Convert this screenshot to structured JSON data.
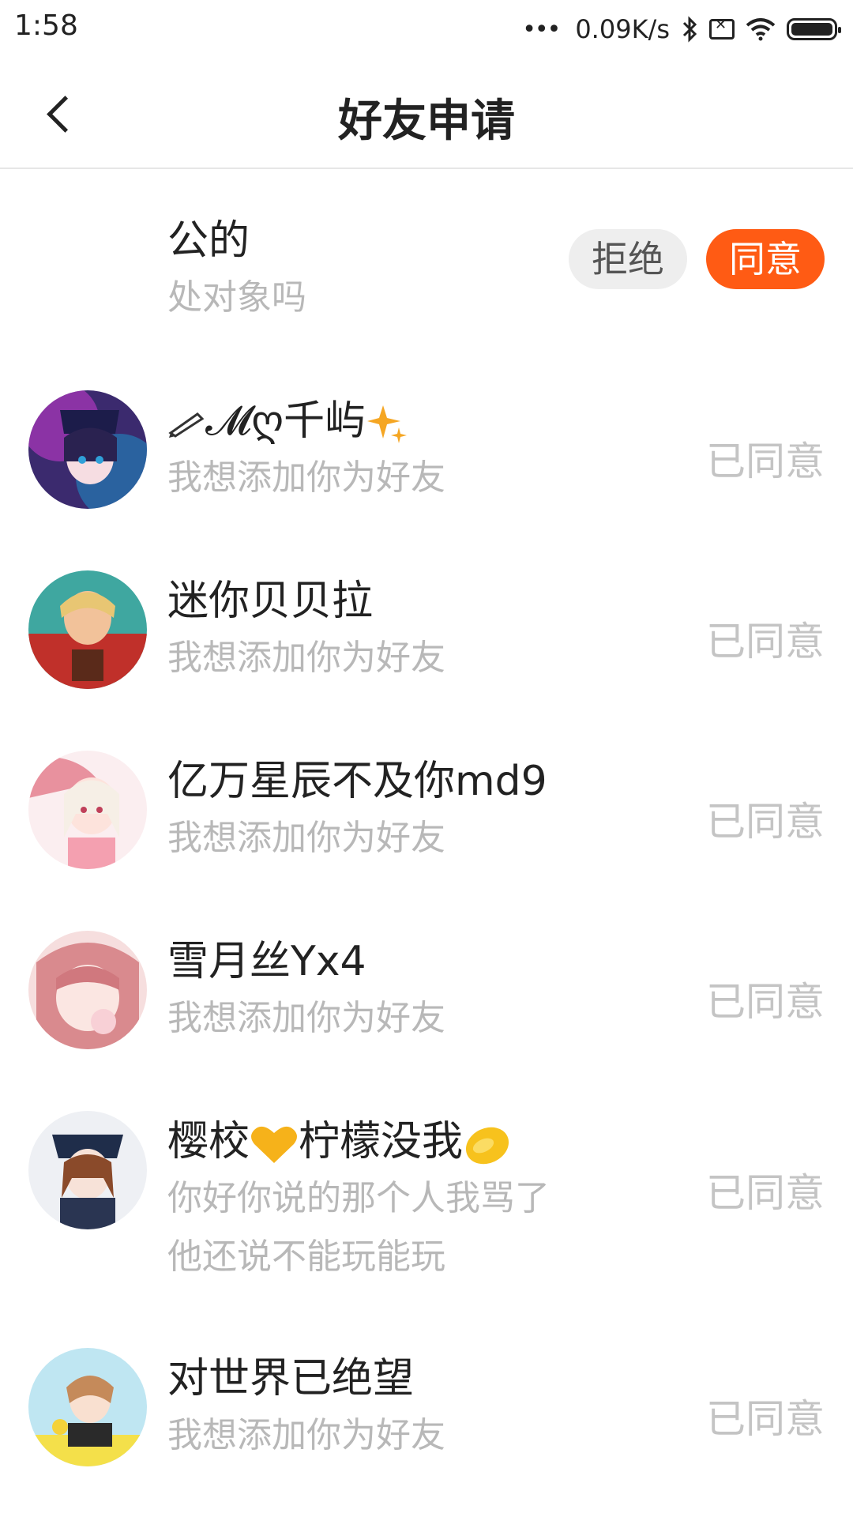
{
  "status_bar": {
    "time": "1:58",
    "network_speed": "0.09K/s",
    "icons": [
      "more-dots-icon",
      "bluetooth-icon",
      "no-sim-icon",
      "wifi-icon",
      "battery-icon"
    ]
  },
  "header": {
    "title": "好友申请",
    "back_icon": "chevron-left-icon"
  },
  "requests": [
    {
      "name": "公的",
      "message": "处对象吗",
      "reject_label": "拒绝",
      "agree_label": "同意",
      "accent_color": "#ff5b14"
    },
    {
      "name_prefix": "✎",
      "name": "𝓜ღ千屿",
      "message": "我想添加你为好友",
      "status": "已同意"
    },
    {
      "name": "迷你贝贝拉",
      "message": "我想添加你为好友",
      "status": "已同意"
    },
    {
      "name": "亿万星辰不及你md9",
      "message": "我想添加你为好友",
      "status": "已同意"
    },
    {
      "name": "雪月丝Yx4",
      "message": "我想添加你为好友",
      "status": "已同意"
    },
    {
      "name_part1": "樱校",
      "name_part2": "柠檬没我",
      "message": "你好你说的那个人我骂了他还说不能玩能玩",
      "status": "已同意"
    },
    {
      "name": "对世界已绝望",
      "message": "我想添加你为好友",
      "status": "已同意"
    }
  ]
}
